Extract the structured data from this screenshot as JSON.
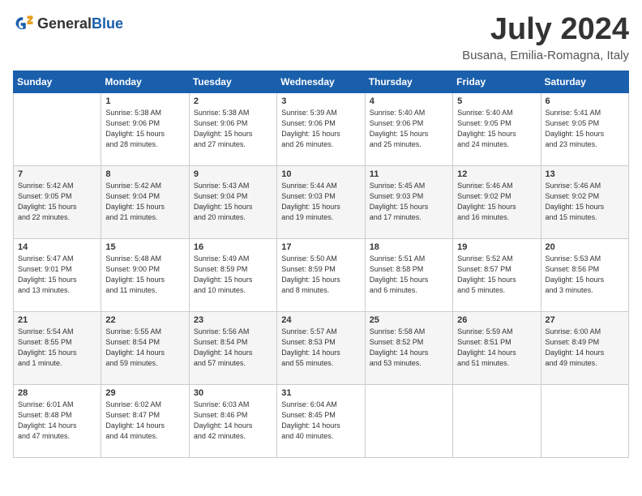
{
  "header": {
    "logo_line1": "General",
    "logo_line2": "Blue",
    "month": "July 2024",
    "location": "Busana, Emilia-Romagna, Italy"
  },
  "days_of_week": [
    "Sunday",
    "Monday",
    "Tuesday",
    "Wednesday",
    "Thursday",
    "Friday",
    "Saturday"
  ],
  "weeks": [
    [
      {
        "day": "",
        "info": ""
      },
      {
        "day": "1",
        "info": "Sunrise: 5:38 AM\nSunset: 9:06 PM\nDaylight: 15 hours\nand 28 minutes."
      },
      {
        "day": "2",
        "info": "Sunrise: 5:38 AM\nSunset: 9:06 PM\nDaylight: 15 hours\nand 27 minutes."
      },
      {
        "day": "3",
        "info": "Sunrise: 5:39 AM\nSunset: 9:06 PM\nDaylight: 15 hours\nand 26 minutes."
      },
      {
        "day": "4",
        "info": "Sunrise: 5:40 AM\nSunset: 9:06 PM\nDaylight: 15 hours\nand 25 minutes."
      },
      {
        "day": "5",
        "info": "Sunrise: 5:40 AM\nSunset: 9:05 PM\nDaylight: 15 hours\nand 24 minutes."
      },
      {
        "day": "6",
        "info": "Sunrise: 5:41 AM\nSunset: 9:05 PM\nDaylight: 15 hours\nand 23 minutes."
      }
    ],
    [
      {
        "day": "7",
        "info": "Sunrise: 5:42 AM\nSunset: 9:05 PM\nDaylight: 15 hours\nand 22 minutes."
      },
      {
        "day": "8",
        "info": "Sunrise: 5:42 AM\nSunset: 9:04 PM\nDaylight: 15 hours\nand 21 minutes."
      },
      {
        "day": "9",
        "info": "Sunrise: 5:43 AM\nSunset: 9:04 PM\nDaylight: 15 hours\nand 20 minutes."
      },
      {
        "day": "10",
        "info": "Sunrise: 5:44 AM\nSunset: 9:03 PM\nDaylight: 15 hours\nand 19 minutes."
      },
      {
        "day": "11",
        "info": "Sunrise: 5:45 AM\nSunset: 9:03 PM\nDaylight: 15 hours\nand 17 minutes."
      },
      {
        "day": "12",
        "info": "Sunrise: 5:46 AM\nSunset: 9:02 PM\nDaylight: 15 hours\nand 16 minutes."
      },
      {
        "day": "13",
        "info": "Sunrise: 5:46 AM\nSunset: 9:02 PM\nDaylight: 15 hours\nand 15 minutes."
      }
    ],
    [
      {
        "day": "14",
        "info": "Sunrise: 5:47 AM\nSunset: 9:01 PM\nDaylight: 15 hours\nand 13 minutes."
      },
      {
        "day": "15",
        "info": "Sunrise: 5:48 AM\nSunset: 9:00 PM\nDaylight: 15 hours\nand 11 minutes."
      },
      {
        "day": "16",
        "info": "Sunrise: 5:49 AM\nSunset: 8:59 PM\nDaylight: 15 hours\nand 10 minutes."
      },
      {
        "day": "17",
        "info": "Sunrise: 5:50 AM\nSunset: 8:59 PM\nDaylight: 15 hours\nand 8 minutes."
      },
      {
        "day": "18",
        "info": "Sunrise: 5:51 AM\nSunset: 8:58 PM\nDaylight: 15 hours\nand 6 minutes."
      },
      {
        "day": "19",
        "info": "Sunrise: 5:52 AM\nSunset: 8:57 PM\nDaylight: 15 hours\nand 5 minutes."
      },
      {
        "day": "20",
        "info": "Sunrise: 5:53 AM\nSunset: 8:56 PM\nDaylight: 15 hours\nand 3 minutes."
      }
    ],
    [
      {
        "day": "21",
        "info": "Sunrise: 5:54 AM\nSunset: 8:55 PM\nDaylight: 15 hours\nand 1 minute."
      },
      {
        "day": "22",
        "info": "Sunrise: 5:55 AM\nSunset: 8:54 PM\nDaylight: 14 hours\nand 59 minutes."
      },
      {
        "day": "23",
        "info": "Sunrise: 5:56 AM\nSunset: 8:54 PM\nDaylight: 14 hours\nand 57 minutes."
      },
      {
        "day": "24",
        "info": "Sunrise: 5:57 AM\nSunset: 8:53 PM\nDaylight: 14 hours\nand 55 minutes."
      },
      {
        "day": "25",
        "info": "Sunrise: 5:58 AM\nSunset: 8:52 PM\nDaylight: 14 hours\nand 53 minutes."
      },
      {
        "day": "26",
        "info": "Sunrise: 5:59 AM\nSunset: 8:51 PM\nDaylight: 14 hours\nand 51 minutes."
      },
      {
        "day": "27",
        "info": "Sunrise: 6:00 AM\nSunset: 8:49 PM\nDaylight: 14 hours\nand 49 minutes."
      }
    ],
    [
      {
        "day": "28",
        "info": "Sunrise: 6:01 AM\nSunset: 8:48 PM\nDaylight: 14 hours\nand 47 minutes."
      },
      {
        "day": "29",
        "info": "Sunrise: 6:02 AM\nSunset: 8:47 PM\nDaylight: 14 hours\nand 44 minutes."
      },
      {
        "day": "30",
        "info": "Sunrise: 6:03 AM\nSunset: 8:46 PM\nDaylight: 14 hours\nand 42 minutes."
      },
      {
        "day": "31",
        "info": "Sunrise: 6:04 AM\nSunset: 8:45 PM\nDaylight: 14 hours\nand 40 minutes."
      },
      {
        "day": "",
        "info": ""
      },
      {
        "day": "",
        "info": ""
      },
      {
        "day": "",
        "info": ""
      }
    ]
  ]
}
